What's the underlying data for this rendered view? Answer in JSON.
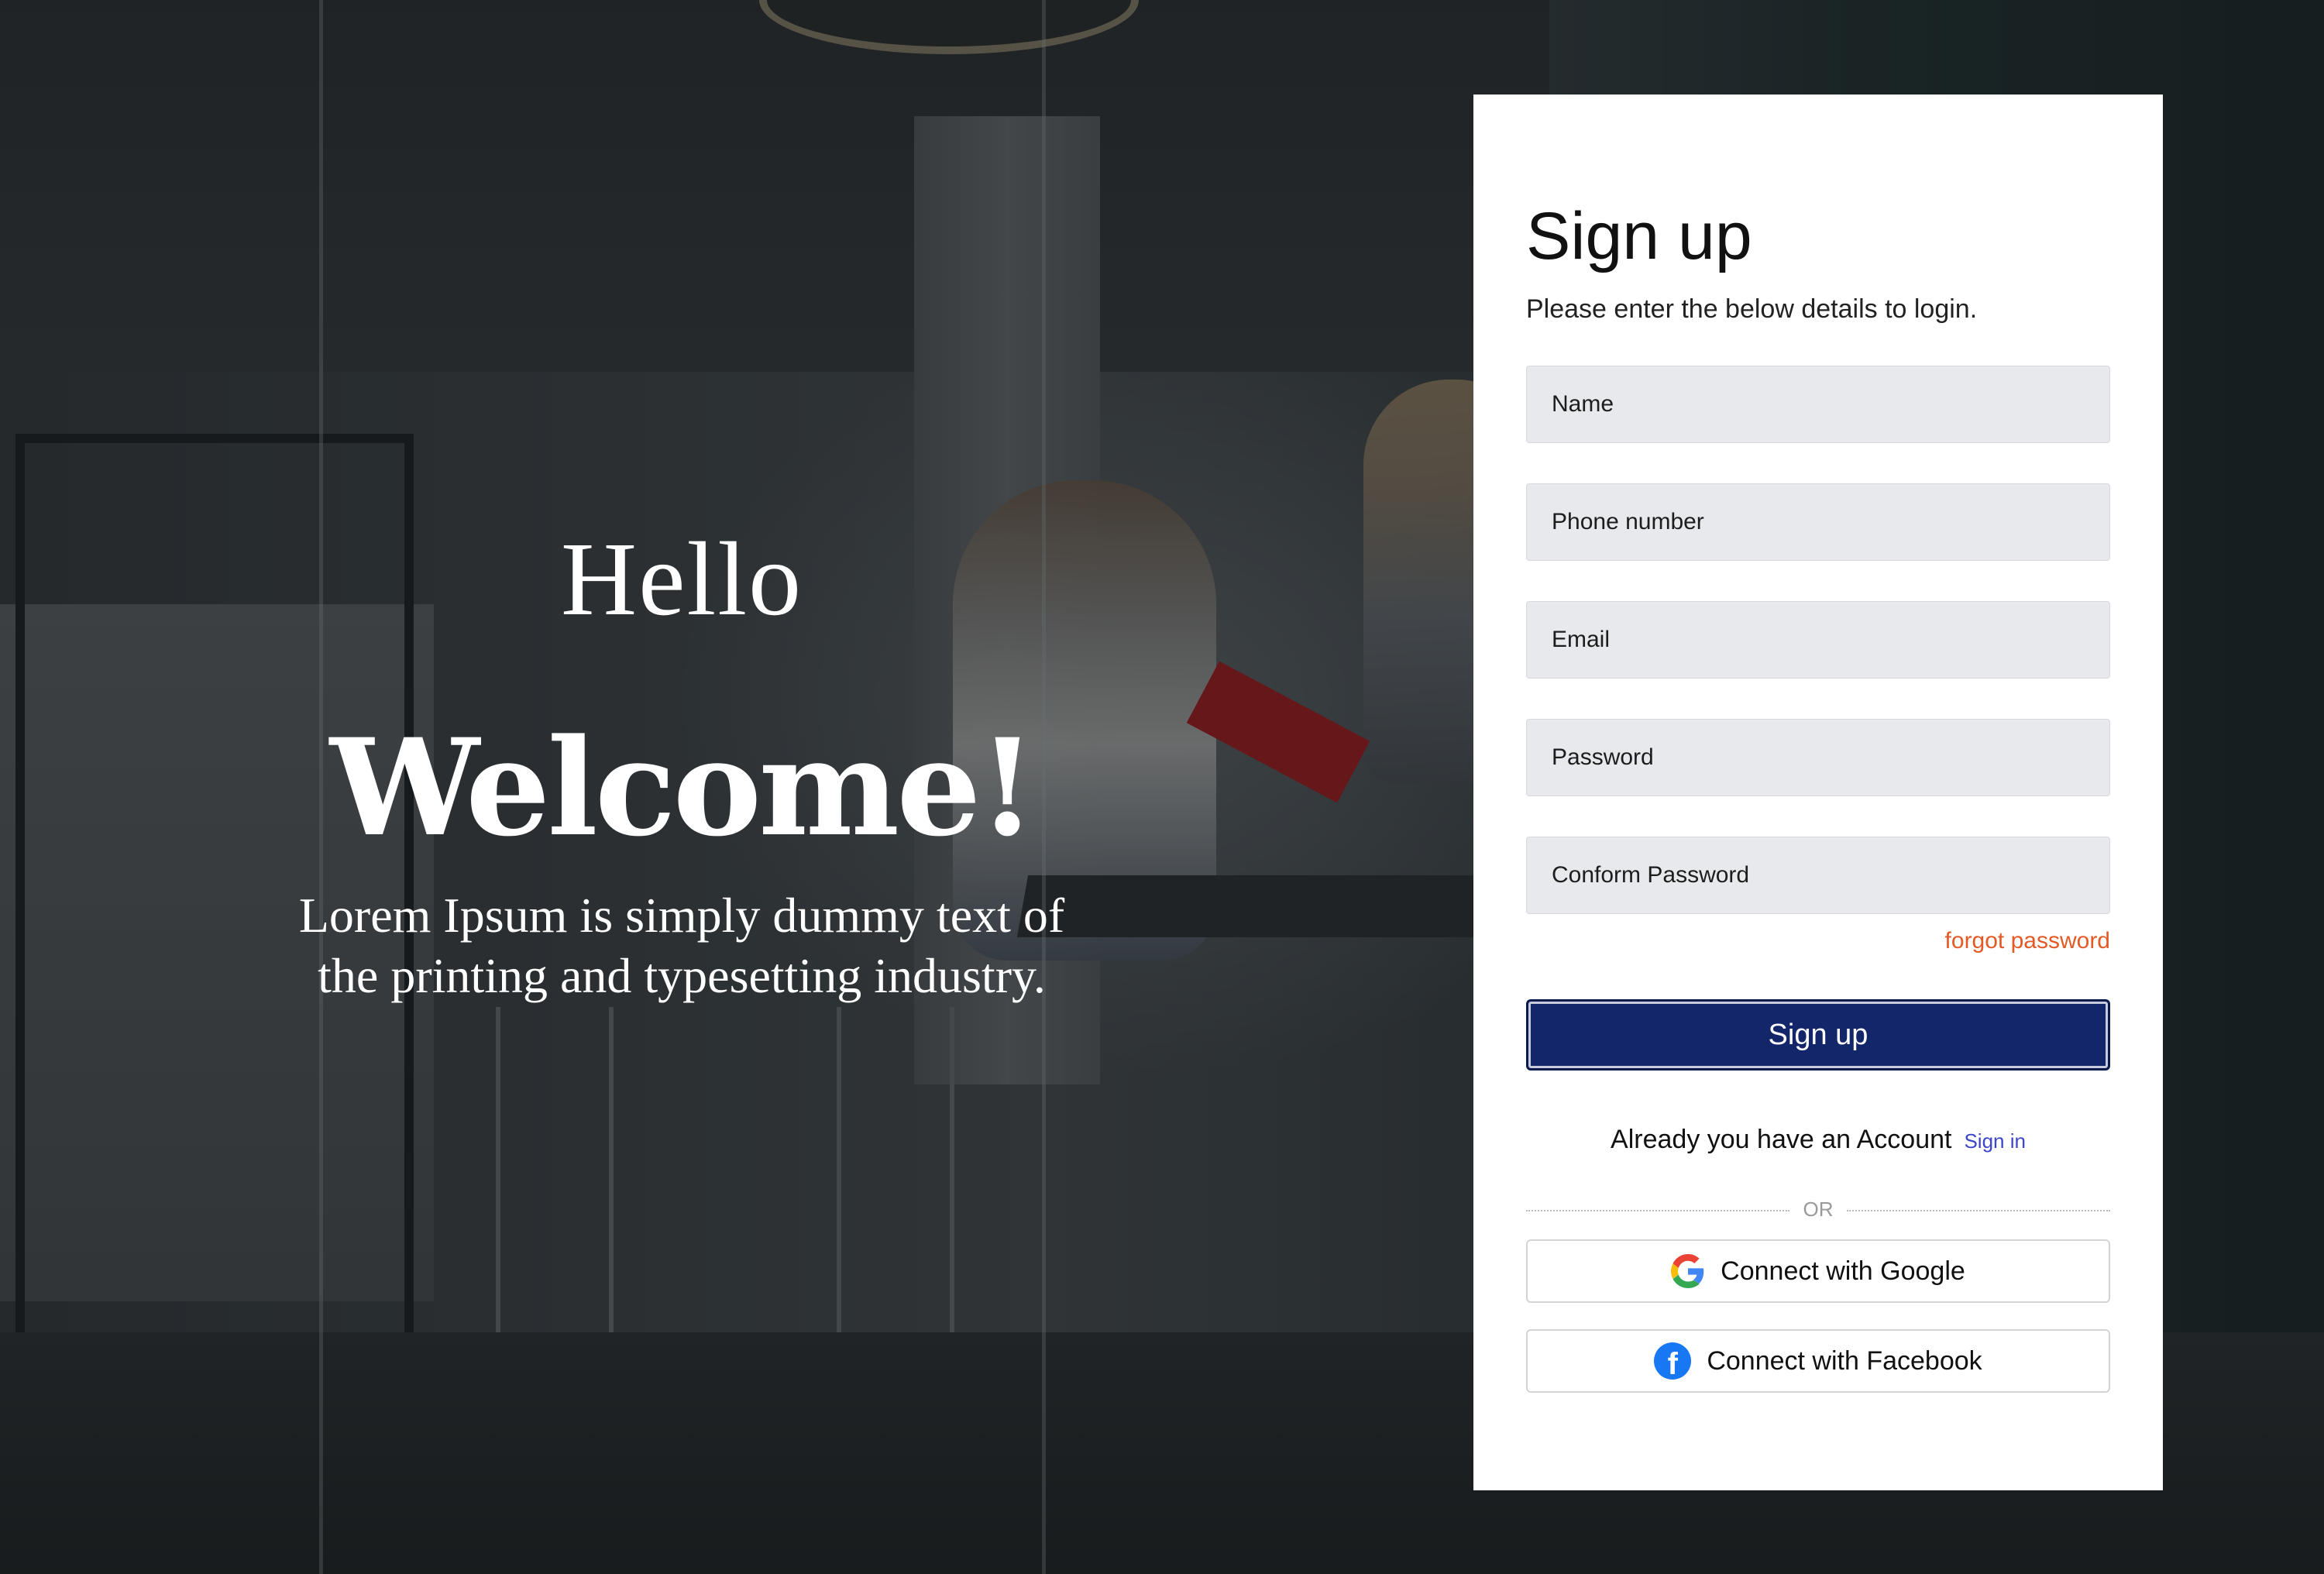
{
  "hero": {
    "hello": "Hello",
    "welcome": "Welcome!",
    "lorem": "Lorem Ipsum is simply dummy text of the printing and typesetting industry."
  },
  "form": {
    "title": "Sign up",
    "subtitle": "Please enter the below details to login.",
    "fields": {
      "name": "Name",
      "phone": "Phone number",
      "email": "Email",
      "password": "Password",
      "confirm_password": "Conform Password"
    },
    "forgot_password": "forgot password",
    "submit_label": "Sign up",
    "account_prompt": "Already you have an Account",
    "sign_in_link": "Sign in",
    "divider_label": "OR",
    "google_label": "Connect with Google",
    "facebook_label": "Connect with Facebook"
  },
  "colors": {
    "primary_button": "#13266a",
    "forgot_link": "#e35a26",
    "sign_in_link": "#3b46c8",
    "field_background": "#e8e9ec"
  },
  "icons": {
    "google": "google-g-icon",
    "facebook": "facebook-f-icon"
  }
}
